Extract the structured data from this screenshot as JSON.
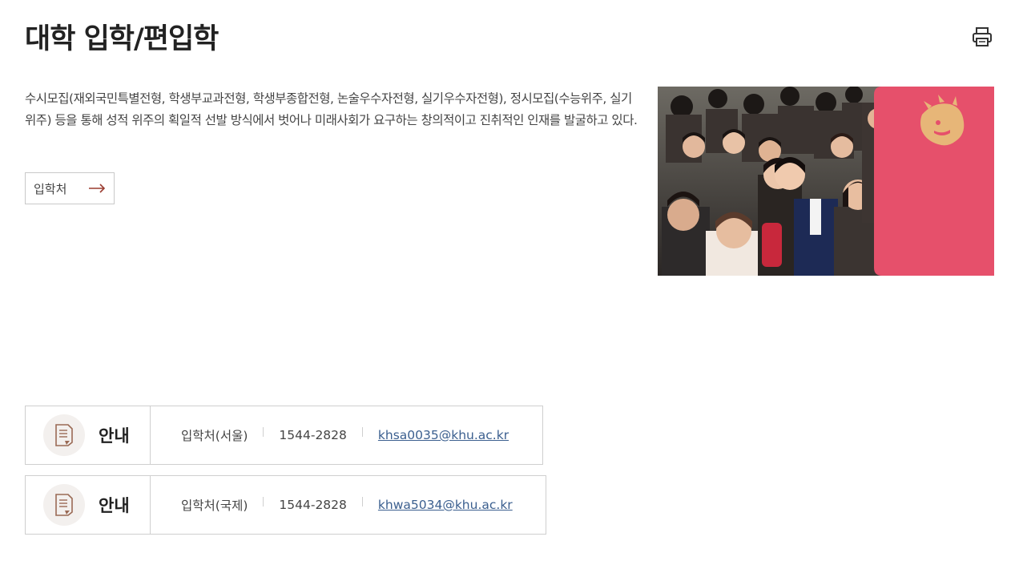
{
  "page": {
    "title": "대학 입학/편입학",
    "description": "수시모집(재외국민특별전형, 학생부교과전형, 학생부종합전형, 논술우수자전형, 실기우수자전형), 정시모집(수능위주, 실기위주) 등을 통해 성적 위주의 획일적 선발 방식에서 벗어나 미래사회가 요구하는 창의적이고 진취적인 인재를 발굴하고 있다.",
    "link_button_label": "입학처",
    "print_icon": "printer-icon",
    "arrow_icon": "arrow-right-icon"
  },
  "colors": {
    "accent_arrow": "#9a3b2f",
    "email_link": "#3b5f8f",
    "banner_pink": "#e6506b",
    "lion_gold": "#e8c27a"
  },
  "info_boxes": [
    {
      "heading": "안내",
      "office": "입학처(서울)",
      "phone": "1544-2828",
      "email": "khsa0035@khu.ac.kr"
    },
    {
      "heading": "안내",
      "office": "입학처(국제)",
      "phone": "1544-2828",
      "email": "khwa5034@khu.ac.kr"
    }
  ]
}
